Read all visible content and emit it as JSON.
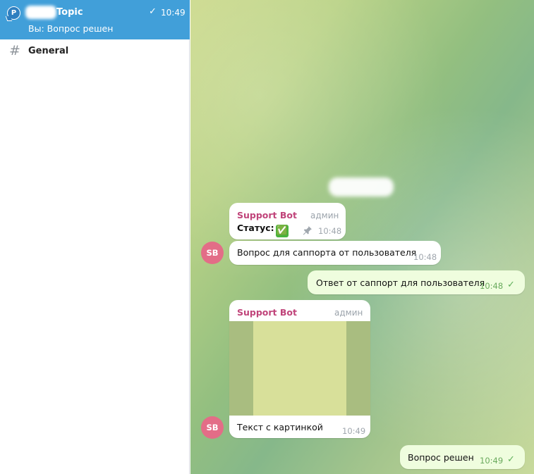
{
  "sidebar": {
    "topic": {
      "avatar_letter": "P",
      "title": "Topic",
      "check": "✓",
      "time": "10:49",
      "preview": "Вы: Вопрос решен"
    },
    "general": {
      "icon": "#",
      "label": "General"
    }
  },
  "colors": {
    "selected_row": "#419fd9",
    "sender_name": "#c0447a",
    "outgoing_bubble": "#effdde",
    "avatar": "#e36d87"
  },
  "chat": {
    "messages": [
      {
        "sender": "Support Bot",
        "role": "админ",
        "text": "Статус:",
        "emoji": "✅",
        "pin_icon": "pin-icon",
        "time": "10:48"
      },
      {
        "avatar": "SB",
        "text": "Вопрос для саппорта от пользователя",
        "time": "10:48"
      },
      {
        "outgoing": true,
        "text": "Ответ от саппорт для пользователя",
        "time": "10:48",
        "tick": "✓"
      },
      {
        "avatar": "SB",
        "sender": "Support Bot",
        "role": "админ",
        "text": "Текст с картинкой",
        "time": "10:49"
      },
      {
        "outgoing": true,
        "text": "Вопрос решен",
        "time": "10:49",
        "tick": "✓"
      }
    ]
  }
}
